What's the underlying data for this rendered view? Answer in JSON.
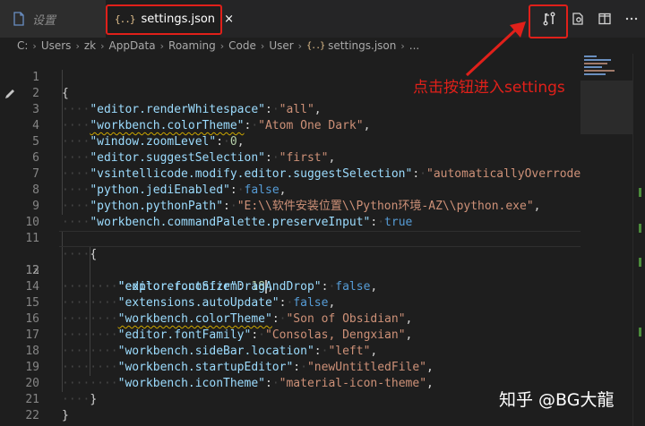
{
  "tabs": [
    {
      "label": "设置",
      "icon": "file-icon",
      "active": false
    },
    {
      "label": "settings.json",
      "icon": "json-braces-icon",
      "active": true,
      "close": "×"
    }
  ],
  "json_icon_glyph": "{..}",
  "breadcrumb": [
    "C:",
    "Users",
    "zk",
    "AppData",
    "Roaming",
    "Code",
    "User",
    "settings.json",
    "..."
  ],
  "breadcrumb_sep": "›",
  "line_numbers": [
    "1",
    "2",
    "3",
    "4",
    "5",
    "6",
    "7",
    "8",
    "9",
    "10",
    "11",
    "12",
    "13",
    "14",
    "15",
    "16",
    "17",
    "18",
    "19",
    "20",
    "21",
    "22"
  ],
  "current_line": "12",
  "code": {
    "brace_open": "{",
    "brace_close": "}",
    "l2_key": "\"editor.renderWhitespace\"",
    "l2_val": "\"all\"",
    "l3_key": "\"workbench.colorTheme\"",
    "l3_val": "\"Atom One Dark\"",
    "l4_key": "\"window.zoomLevel\"",
    "l4_val": "0",
    "l5_key": "\"editor.suggestSelection\"",
    "l5_val": "\"first\"",
    "l6_key": "\"vsintellicode.modify.editor.suggestSelection\"",
    "l6_val": "\"automaticallyOverrodeDefa",
    "l7_key": "\"python.jediEnabled\"",
    "l7_val": "false",
    "l8_key": "\"python.pythonPath\"",
    "l8_val": "\"E:\\\\软件安装位置\\\\Python环境-AZ\\\\python.exe\"",
    "l9_key": "\"workbench.commandPalette.preserveInput\"",
    "l9_val": "true",
    "l12_key": "\"editor.fontSize\"",
    "l12_val": "18",
    "l13_key": "\"explorer.confirmDragAndDrop\"",
    "l13_val": "false",
    "l14_key": "\"extensions.autoUpdate\"",
    "l14_val": "false",
    "l15_key": "\"workbench.colorTheme\"",
    "l15_val": "\"Son of Obsidian\"",
    "l16_key": "\"editor.fontFamily\"",
    "l16_val": "\"Consolas, Dengxian\"",
    "l17_key": "\"workbench.sideBar.location\"",
    "l17_val": "\"left\"",
    "l18_key": "\"workbench.startupEditor\"",
    "l18_val": "\"newUntitledFile\"",
    "l19_key": "\"workbench.iconTheme\"",
    "l19_val": "\"material-icon-theme\""
  },
  "annotation": "点击按钮进入settings",
  "watermark": "知乎 @BG大龍",
  "editor_actions": [
    "open-settings-ui-icon",
    "open-changes-icon",
    "split-editor-icon"
  ],
  "colors": {
    "highlight_red": "#e0201a",
    "key": "#9cdcfe",
    "string": "#ce9178",
    "number": "#b5cea8",
    "boolean": "#569cd6",
    "background": "#1e1e1e"
  }
}
